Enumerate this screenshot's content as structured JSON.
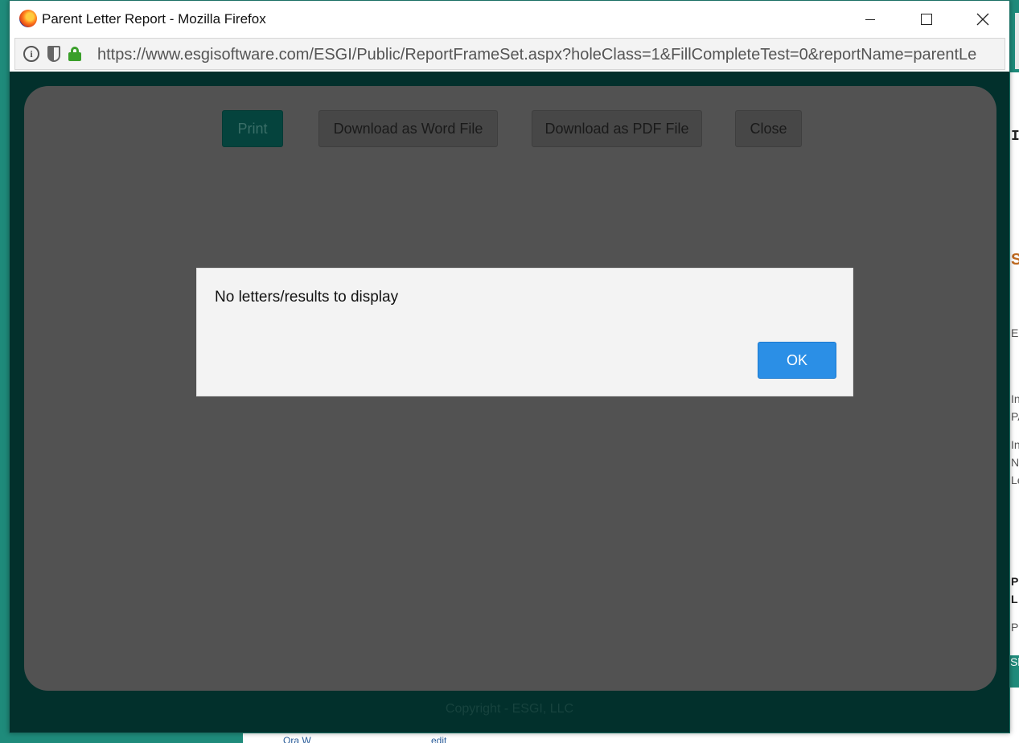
{
  "window": {
    "title": "Parent Letter Report - Mozilla Firefox",
    "url": "https://www.esgisoftware.com/ESGI/Public/ReportFrameSet.aspx?holeClass=1&FillCompleteTest=0&reportName=parentLe"
  },
  "toolbar": {
    "print": "Print",
    "download_word": "Download as Word File",
    "download_pdf": "Download as PDF File",
    "close": "Close"
  },
  "dialog": {
    "message": "No letters/results to display",
    "ok": "OK"
  },
  "footer": {
    "copyright": "Copyright - ESGI, LLC"
  },
  "background": {
    "right_fragments": [
      "I",
      "S",
      "E",
      "In",
      "PA",
      "In",
      "N",
      "Le",
      "P",
      "L",
      "P",
      "Sl"
    ],
    "bottom_fragments": [
      "Ora W",
      "edit"
    ]
  },
  "colors": {
    "page_background": "#02302c",
    "overlay": "#525252",
    "primary_button": "#2b8fe6",
    "print_button": "#05433d"
  }
}
